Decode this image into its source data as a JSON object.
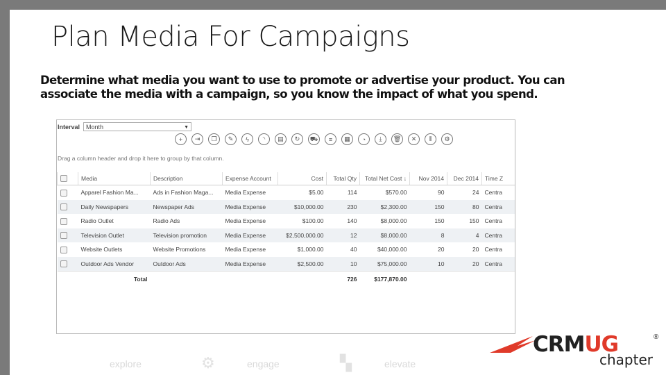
{
  "slide": {
    "title": "Plan Media For Campaigns",
    "body": "Determine what media you want to use to promote or advertise your product. You can associate the media with a campaign, so you know the impact of what you spend."
  },
  "screenshot": {
    "interval_label": "Interval",
    "interval_value": "Month",
    "toolbar_icons": [
      "add-icon",
      "import-icon",
      "copy-icon",
      "edit-icon",
      "lightning-icon",
      "feed-icon",
      "document-icon",
      "refresh-icon",
      "cart-icon",
      "database-icon",
      "report-icon",
      "pie-chart-icon",
      "download-icon",
      "delete-icon",
      "expand-icon",
      "columns-icon",
      "settings-icon"
    ],
    "group_hint": "Drag a column header and drop it here to group by that column.",
    "columns": [
      "Media",
      "Description",
      "Expense Account",
      "Cost",
      "Total Qty",
      "Total Net Cost ↓",
      "Nov 2014",
      "Dec 2014",
      "Time Z"
    ],
    "rows": [
      [
        "Apparel Fashion Ma...",
        "Ads in Fashion Maga...",
        "Media Expense",
        "$5.00",
        "114",
        "$570.00",
        "90",
        "24",
        "Centra"
      ],
      [
        "Daily Newspapers",
        "Newspaper Ads",
        "Media Expense",
        "$10,000.00",
        "230",
        "$2,300.00",
        "150",
        "80",
        "Centra"
      ],
      [
        "Radio Outlet",
        "Radio Ads",
        "Media Expense",
        "$100.00",
        "140",
        "$8,000.00",
        "150",
        "150",
        "Centra"
      ],
      [
        "Television Outlet",
        "Television promotion",
        "Media Expense",
        "$2,500,000.00",
        "12",
        "$8,000.00",
        "8",
        "4",
        "Centra"
      ],
      [
        "Website Outlets",
        "Website Promotions",
        "Media Expense",
        "$1,000.00",
        "40",
        "$40,000.00",
        "20",
        "20",
        "Centra"
      ],
      [
        "Outdoor Ads Vendor",
        "Outdoor Ads",
        "Media Expense",
        "$2,500.00",
        "10",
        "$75,000.00",
        "10",
        "20",
        "Centra"
      ]
    ],
    "total": {
      "label": "Total",
      "qty": "726",
      "net_cost": "$177,870.00"
    }
  },
  "footer": {
    "words": [
      "explore",
      "engage",
      "elevate"
    ],
    "icons": [
      "gear-icon",
      "blocks-icon"
    ]
  },
  "logo": {
    "main_crm": "CRM",
    "main_ug": "UG",
    "reg": "®",
    "sub": "chapter",
    "accent_color": "#e03a2a"
  }
}
